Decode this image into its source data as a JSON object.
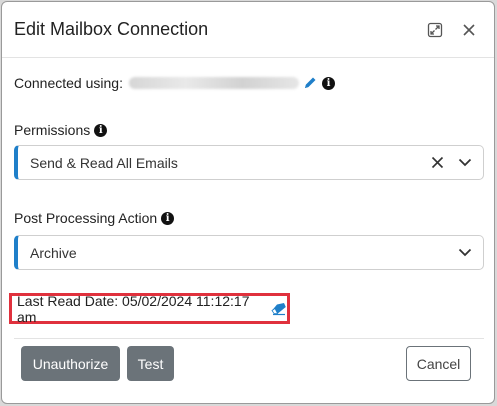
{
  "dialog": {
    "title": "Edit Mailbox Connection",
    "icons": {
      "expand": "expand-icon",
      "close": "close-icon"
    }
  },
  "connected": {
    "label": "Connected using:",
    "email_redacted": true,
    "icons": {
      "edit": "pencil-icon",
      "info": "info-icon"
    }
  },
  "permissions": {
    "label": "Permissions",
    "value": "Send & Read All Emails",
    "icons": {
      "info": "info-icon",
      "clear": "x-icon",
      "dropdown": "chevron-down-icon"
    }
  },
  "post_processing": {
    "label": "Post Processing Action",
    "value": "Archive",
    "icons": {
      "info": "info-icon",
      "dropdown": "chevron-down-icon"
    }
  },
  "last_read": {
    "text": "Last Read Date: 05/02/2024 11:12:17 am",
    "icons": {
      "reset": "eraser-icon"
    },
    "highlight_color": "#e0313d"
  },
  "footer": {
    "unauthorize_label": "Unauthorize",
    "test_label": "Test",
    "cancel_label": "Cancel"
  },
  "colors": {
    "accent": "#1f7fc9",
    "button_dark": "#6b7379",
    "highlight": "#e0313d"
  }
}
